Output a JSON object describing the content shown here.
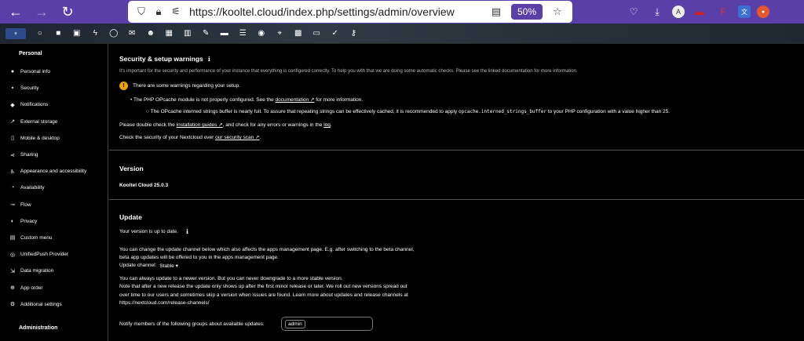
{
  "browser": {
    "url": "https://kooltel.cloud/index.php/settings/admin/overview",
    "zoom": "50%"
  },
  "sidebar": {
    "section_personal": "Personal",
    "items": [
      {
        "label": "Personal info",
        "icon": "person-icon"
      },
      {
        "label": "Security",
        "icon": "lock-icon"
      },
      {
        "label": "Notifications",
        "icon": "bell-icon"
      },
      {
        "label": "External storage",
        "icon": "external-link-icon"
      },
      {
        "label": "Mobile & desktop",
        "icon": "phone-icon"
      },
      {
        "label": "Sharing",
        "icon": "share-icon"
      },
      {
        "label": "Appearance and accessibility",
        "icon": "accessibility-icon"
      },
      {
        "label": "Availability",
        "icon": "clock-icon"
      },
      {
        "label": "Flow",
        "icon": "flow-icon"
      },
      {
        "label": "Privacy",
        "icon": "privacy-icon"
      },
      {
        "label": "Custom menu",
        "icon": "menu-icon"
      },
      {
        "label": "UnifiedPush Provider",
        "icon": "push-icon"
      },
      {
        "label": "Data migration",
        "icon": "migration-icon"
      },
      {
        "label": "App order",
        "icon": "app-order-icon"
      },
      {
        "label": "Additional settings",
        "icon": "settings-icon"
      }
    ],
    "section_admin": "Administration"
  },
  "security": {
    "title": "Security & setup warnings",
    "intro": "It's important for the security and performance of your instance that everything is configured correctly. To help you with that we are doing some automatic checks. Please see the linked documentation for more information.",
    "warning_header": "There are some warnings regarding your setup.",
    "opcache_pre": "The PHP OPcache module is not properly configured. See the",
    "opcache_link": "documentation ↗",
    "opcache_post": "for more information.",
    "buffer_pre": "The OPcache interned strings buffer is nearly full. To assure that repeating strings can be effectively cached, it is recommended to apply",
    "buffer_code": "opcache.interned_strings_buffer",
    "buffer_post": "to your PHP configuration with a value higher than",
    "buffer_value": "25.",
    "check_pre": "Please double check the",
    "check_link1": "installation guides ↗",
    "check_mid": ", and check for any errors or warnings in the",
    "check_link2": "log",
    "check_end": ".",
    "scan_pre": "Check the security of your Nextcloud over",
    "scan_link": "our security scan ↗",
    "scan_end": "."
  },
  "version": {
    "title": "Version",
    "value": "Kooltel Cloud 25.0.3"
  },
  "update": {
    "title": "Update",
    "status": "Your version is up to date.",
    "channel_line1": "You can change the update channel below which also affects the apps management page. E.g. after switching to the beta channel,",
    "channel_line2": "beta app updates will be offered to you in the apps management page.",
    "channel_label": "Update channel:",
    "channel_value": "Stable",
    "note_line1": "You can always update to a newer version. But you can never downgrade to a more stable version.",
    "note_line2": "Note that after a new release the update only shows up after the first minor release or later. We roll out new versions spread out",
    "note_line3": "over time to our users and sometimes skip a version when issues are found. Learn more about updates and release channels at",
    "note_line4": "https://nextcloud.com/release-channels/",
    "notify_label": "Notify members of the following groups about available updates:",
    "notify_group": "admin"
  }
}
